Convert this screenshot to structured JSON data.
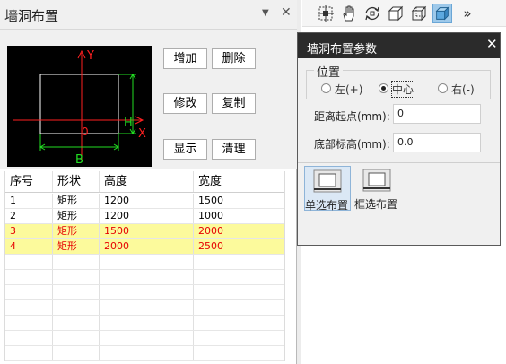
{
  "left_panel": {
    "title": "墙洞布置",
    "pin_glyph": "▼",
    "close_glyph": "✕",
    "preview": {
      "y_label": "Y",
      "x_label": "X",
      "h_label": "H",
      "b_label": "B",
      "origin_label": "0"
    },
    "buttons": {
      "add": "增加",
      "delete": "删除",
      "modify": "修改",
      "copy": "复制",
      "show": "显示",
      "clear": "清理"
    },
    "table": {
      "headers": [
        "序号",
        "形状",
        "高度",
        "宽度"
      ],
      "rows": [
        {
          "no": "1",
          "shape": "矩形",
          "height": "1200",
          "width": "1500",
          "highlighted": false
        },
        {
          "no": "2",
          "shape": "矩形",
          "height": "1200",
          "width": "1000",
          "highlighted": false
        },
        {
          "no": "3",
          "shape": "矩形",
          "height": "1500",
          "width": "2000",
          "highlighted": true
        },
        {
          "no": "4",
          "shape": "矩形",
          "height": "2000",
          "width": "2500",
          "highlighted": true
        }
      ]
    }
  },
  "toolbar": {
    "icons": [
      "grid-select-icon",
      "hand-pan-icon",
      "rotate-view-icon",
      "box-view-icon",
      "wire-box-icon",
      "solid-box-icon",
      "chevron-more-icon"
    ],
    "active_icon": "solid-box-icon",
    "more_glyph": "»"
  },
  "dialog": {
    "title": "墙洞布置参数",
    "close_glyph": "✕",
    "position_group": {
      "legend": "位置",
      "options": [
        "左(+)",
        "中心",
        "右(-)"
      ],
      "selected": "中心"
    },
    "distance_label": "距离起点(mm):",
    "distance_value": "0",
    "bottom_elevation_label": "底部标高(mm):",
    "bottom_elevation_value": "0.0",
    "modes": [
      "单选布置",
      "框选布置"
    ],
    "selected_mode": "单选布置"
  },
  "colors": {
    "highlight_row": "#fcfa9c",
    "highlight_text": "#e60000",
    "preview_bg": "#000000",
    "axis_red": "#ff2020",
    "dim_green": "#22dd22",
    "dialog_title_bg": "#2b2b2b",
    "active_tool": "#9ec9ea"
  }
}
